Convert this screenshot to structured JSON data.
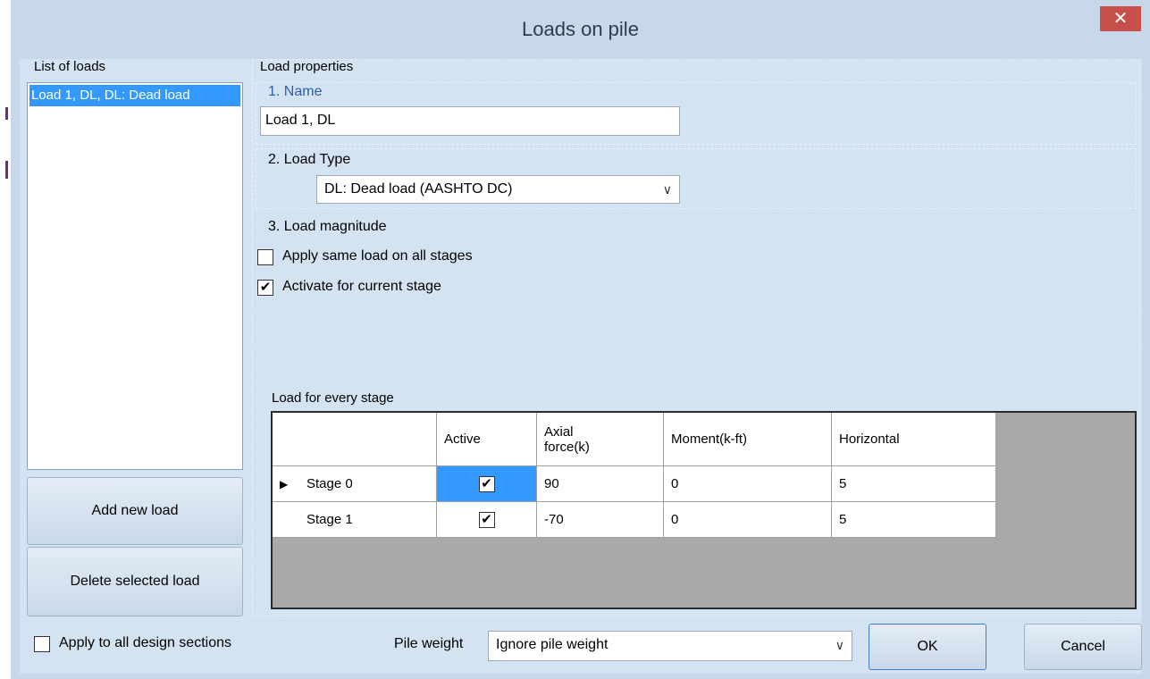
{
  "window": {
    "title": "Loads on pile",
    "close_glyph": "✕"
  },
  "left": {
    "group_label": "List of loads",
    "items": [
      {
        "label": "Load 1, DL, DL: Dead load",
        "selected": true
      }
    ],
    "add_button": "Add new load",
    "delete_button": "Delete selected load"
  },
  "properties": {
    "group_label": "Load properties",
    "name_label": "1. Name",
    "name_value": "Load 1, DL",
    "type_label": "2. Load Type",
    "type_value": "DL: Dead load (AASHTO DC)",
    "magnitude_label": "3. Load magnitude",
    "apply_same_label": "Apply same load on all stages",
    "apply_same_checked": false,
    "activate_label": "Activate for current stage",
    "activate_checked": true
  },
  "grid": {
    "group_label": "Load for every stage",
    "columns": [
      "",
      "Active",
      "Axial force(k)",
      "Moment(k-ft)",
      "Horizontal"
    ],
    "rows": [
      {
        "name": "Stage 0",
        "active": true,
        "axial": "90",
        "moment": "0",
        "horizontal": "5",
        "current": true
      },
      {
        "name": "Stage 1",
        "active": true,
        "axial": "-70",
        "moment": "0",
        "horizontal": "5",
        "current": false
      }
    ],
    "row_indicator": "▶",
    "check_glyph": "✔"
  },
  "bottom": {
    "apply_all_label": "Apply to all design sections",
    "apply_all_checked": false,
    "pile_weight_label": "Pile weight",
    "pile_weight_value": "Ignore pile weight",
    "ok": "OK",
    "cancel": "Cancel"
  },
  "icons": {
    "dropdown": "chevron-down-icon",
    "close": "close-icon",
    "row": "row-indicator-icon"
  },
  "colors": {
    "selection": "#3399ff",
    "close": "#c7504b",
    "dialog": "#d4e3f2"
  }
}
